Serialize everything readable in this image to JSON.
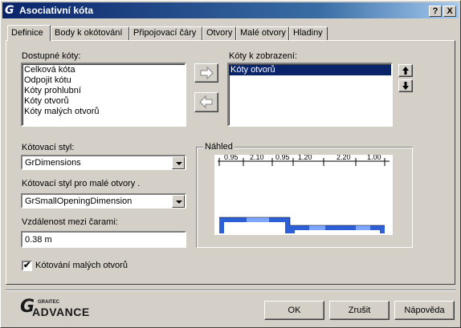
{
  "window": {
    "title": "Asociativní kóta",
    "icon_name": "graitec-g-icon",
    "help_label": "?",
    "close_label": "X"
  },
  "tabs": [
    {
      "label": "Definice",
      "active": true
    },
    {
      "label": "Body k okótování",
      "active": false
    },
    {
      "label": "Připojovací čáry",
      "active": false
    },
    {
      "label": "Otvory",
      "active": false
    },
    {
      "label": "Malé otvory",
      "active": false
    },
    {
      "label": "Hladiny",
      "active": false
    }
  ],
  "available": {
    "label": "Dostupné kóty:",
    "items": [
      "Celková kóta",
      "Odpojit kótu",
      "Kóty prohlubní",
      "Kóty otvorů",
      "Kóty malých otvorů"
    ]
  },
  "to_display": {
    "label": "Kóty k zobrazení:",
    "items": [
      "Kóty otvorů"
    ],
    "selected": "Kóty otvorů"
  },
  "move_buttons": {
    "add_icon": "arrow-right-icon",
    "remove_icon": "arrow-left-icon",
    "up_icon": "arrow-up-icon",
    "down_icon": "arrow-down-icon"
  },
  "dimension_style": {
    "label": "Kótovací styl:",
    "value": "GrDimensions"
  },
  "small_opening_style": {
    "label": "Kótovací styl pro malé otvory .",
    "value": "GrSmallOpeningDimension"
  },
  "line_distance": {
    "label": "Vzdálenost mezi čarami:",
    "value": "0.38 m"
  },
  "small_openings_checkbox": {
    "label": "Kótování malých otvorů",
    "checked": true,
    "mark": "✔"
  },
  "preview": {
    "label": "Náhled",
    "dims": [
      "0.95",
      "2.10",
      "0.95",
      "1.20",
      "2.20",
      "1.00"
    ],
    "colors": {
      "wall": "#2d5fd6",
      "wall_light": "#7ea6ff",
      "line": "#000000"
    }
  },
  "footer": {
    "brand_small": "GRAITEC",
    "brand_big": "ADVANCE",
    "brand_g": "G",
    "ok_label": "OK",
    "cancel_label": "Zrušit",
    "help_label": "Nápověda"
  }
}
